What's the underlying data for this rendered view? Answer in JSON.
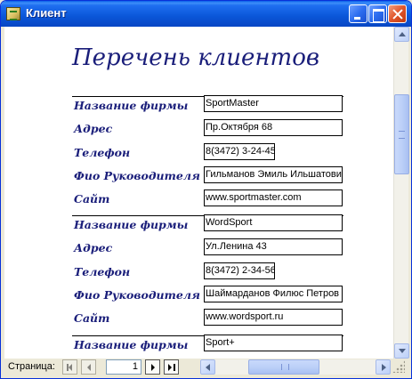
{
  "window": {
    "title": "Клиент"
  },
  "report": {
    "title": "Перечень клиентов",
    "labels": {
      "company": "Название фирмы",
      "address": "Адрес",
      "phone": "Телефон",
      "director": "Фио Руководителя",
      "site": "Сайт"
    },
    "records": [
      {
        "company": "SportMaster",
        "address": "Пр.Октября 68",
        "phone": "8(3472) 3-24-45",
        "director": "Гильманов Эмиль Ильшатови",
        "site": "www.sportmaster.com"
      },
      {
        "company": "WordSport",
        "address": "Ул.Ленина 43",
        "phone": "8(3472) 2-34-56",
        "director": "Шаймарданов Филюс Петров",
        "site": "www.wordsport.ru"
      },
      {
        "company": "Sport+"
      }
    ]
  },
  "navigation": {
    "page_label": "Страница:",
    "current_page": "1"
  },
  "icons": {
    "app": "report-icon",
    "minimize": "minimize-icon",
    "maximize": "maximize-icon",
    "close": "close-icon"
  },
  "colors": {
    "titlebar": "#0a56d8",
    "report_text": "#1a1e7a",
    "scrollbar": "#bcd0f8"
  }
}
